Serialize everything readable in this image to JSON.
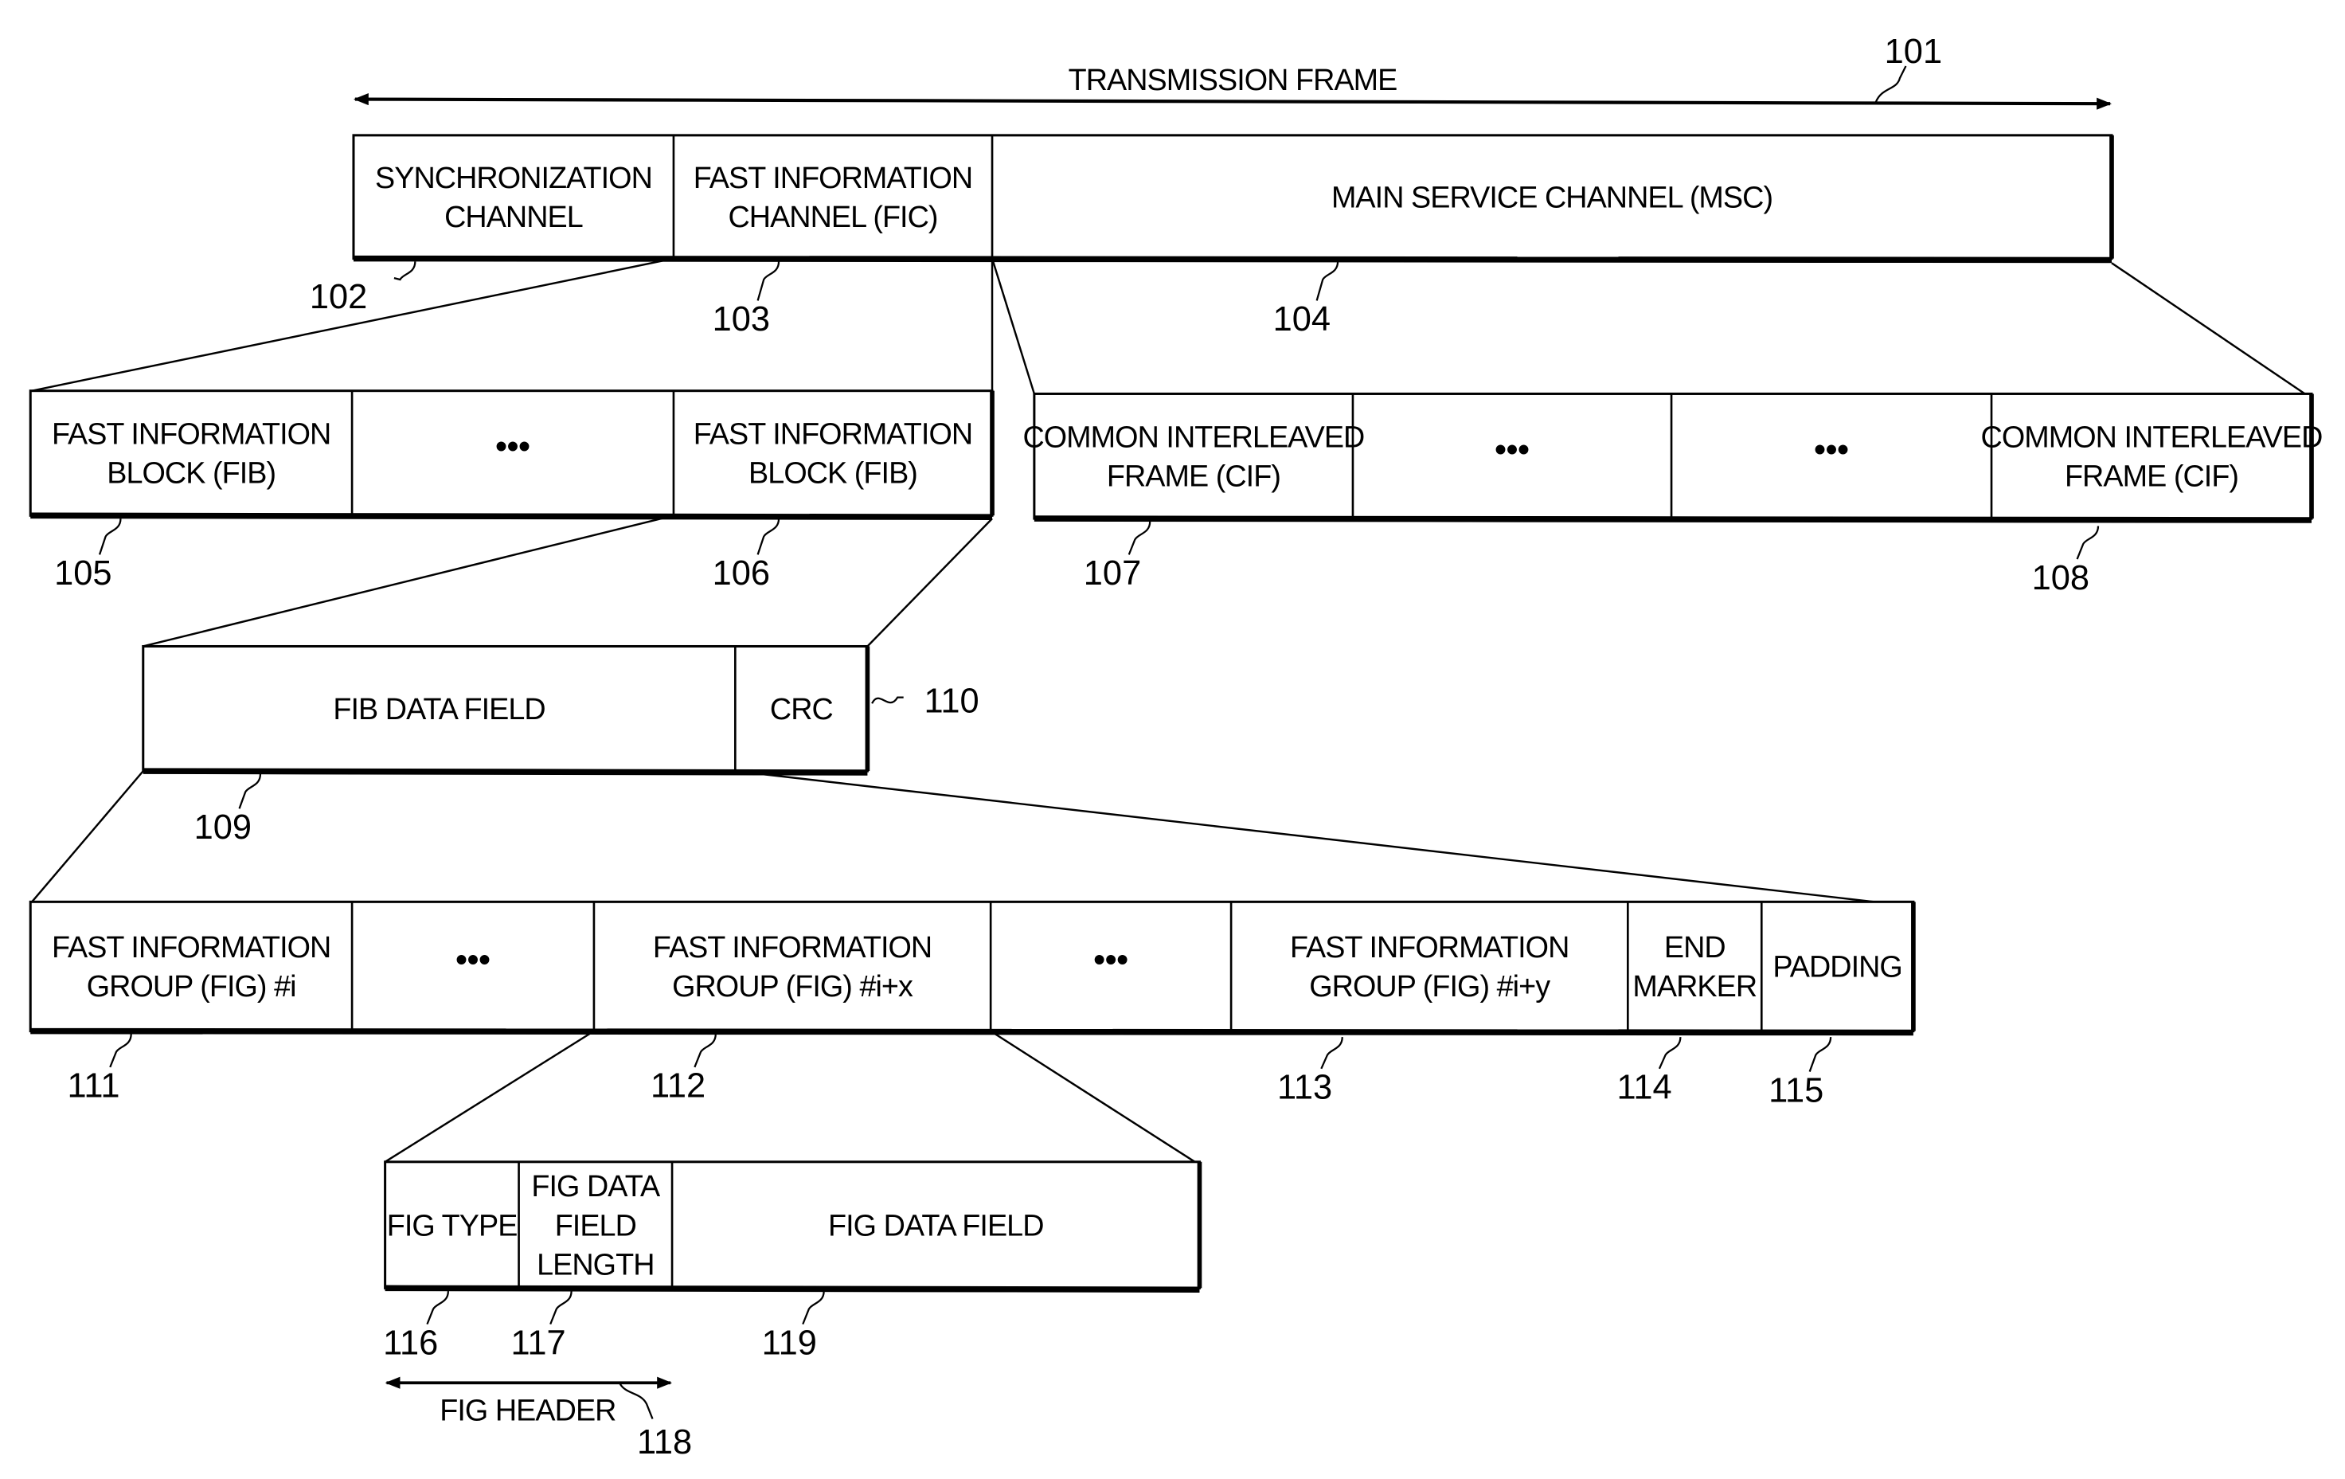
{
  "figure": {
    "transmission_frame": {
      "label": "TRANSMISSION FRAME",
      "ref": "101"
    },
    "frame_row": {
      "cells": [
        {
          "lines": [
            "SYNCHRONIZATION",
            "CHANNEL"
          ],
          "ref": "102"
        },
        {
          "lines": [
            "FAST INFORMATION",
            "CHANNEL (FIC)"
          ],
          "ref": "103"
        },
        {
          "lines": [
            "MAIN SERVICE CHANNEL (MSC)"
          ],
          "ref": "104"
        }
      ]
    },
    "fic_row": {
      "cells": [
        {
          "lines": [
            "FAST INFORMATION",
            "BLOCK (FIB)"
          ],
          "ref": "105"
        },
        {
          "lines": [
            "..."
          ]
        },
        {
          "lines": [
            "FAST INFORMATION",
            "BLOCK (FIB)"
          ],
          "ref": "106"
        }
      ]
    },
    "msc_row": {
      "cells": [
        {
          "lines": [
            "COMMON INTERLEAVED",
            "FRAME (CIF)"
          ],
          "ref": "107"
        },
        {
          "lines": [
            "..."
          ]
        },
        {
          "lines": [
            "..."
          ]
        },
        {
          "lines": [
            "COMMON INTERLEAVED",
            "FRAME (CIF)"
          ],
          "ref": "108"
        }
      ]
    },
    "fib_row": {
      "cells": [
        {
          "lines": [
            "FIB DATA FIELD"
          ],
          "ref": "109"
        },
        {
          "lines": [
            "CRC"
          ],
          "ref": "110"
        }
      ]
    },
    "fig_row": {
      "cells": [
        {
          "lines": [
            "FAST INFORMATION",
            "GROUP (FIG) #i"
          ],
          "ref": "111"
        },
        {
          "lines": [
            "..."
          ]
        },
        {
          "lines": [
            "FAST INFORMATION",
            "GROUP (FIG) #i+x"
          ],
          "ref": "112"
        },
        {
          "lines": [
            "..."
          ]
        },
        {
          "lines": [
            "FAST INFORMATION",
            "GROUP (FIG) #i+y"
          ],
          "ref": "113"
        },
        {
          "lines": [
            "END",
            "MARKER"
          ],
          "ref": "114"
        },
        {
          "lines": [
            "PADDING"
          ],
          "ref": "115"
        }
      ]
    },
    "fig_detail_row": {
      "cells": [
        {
          "lines": [
            "FIG TYPE"
          ],
          "ref": "116"
        },
        {
          "lines": [
            "FIG DATA",
            "FIELD",
            "LENGTH"
          ],
          "ref": "117"
        },
        {
          "lines": [
            "FIG DATA FIELD"
          ],
          "ref": "119"
        }
      ]
    },
    "fig_header": {
      "label": "FIG HEADER",
      "ref": "118"
    }
  }
}
